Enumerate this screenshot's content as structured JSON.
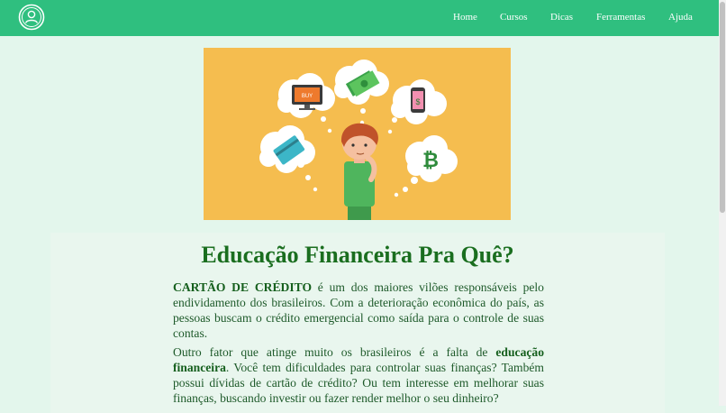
{
  "nav": {
    "items": [
      {
        "label": "Home"
      },
      {
        "label": "Cursos"
      },
      {
        "label": "Dicas"
      },
      {
        "label": "Ferramentas"
      },
      {
        "label": "Ajuda"
      }
    ],
    "logo_icon": "user-profile-icon"
  },
  "hero": {
    "icons": [
      "credit-card-icon",
      "computer-buy-icon",
      "cash-icon",
      "smartphone-pay-icon",
      "bitcoin-icon"
    ],
    "screen_text": "BUY",
    "bitcoin_symbol": "₿"
  },
  "article": {
    "title": "Educação Financeira Pra Quê?",
    "p1_highlight": "CARTÃO DE CRÉDITO",
    "p1_text": " é um dos maiores vilões responsáveis pelo endividamento dos brasileiros. Com a deterioração econômica do país, as pessoas buscam o crédito emergencial como saída para o controle de suas contas.",
    "p2_text_a": "Outro fator que atinge muito os brasileiros é a falta de ",
    "p2_highlight": "educação financeira",
    "p2_text_b": ". Você tem dificuldades para controlar suas finanças? Também possui dívidas de cartão de crédito? Ou tem interesse em melhorar suas finanças, buscando investir ou fazer render melhor o seu dinheiro?"
  },
  "colors": {
    "navbar": "#2fbf7f",
    "background": "#e3f6ec",
    "hero_background": "#f5bd4f",
    "title": "#1a6e1f",
    "text": "#1e5a2a"
  }
}
